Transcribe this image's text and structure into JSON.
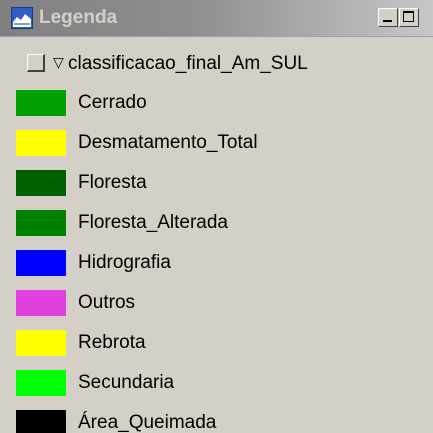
{
  "window": {
    "title": "Legenda"
  },
  "layer": {
    "name": "classificacao_final_Am_SUL",
    "checked": false,
    "expanded": true
  },
  "legend": {
    "items": [
      {
        "label": "Cerrado",
        "color": "#00a000"
      },
      {
        "label": "Desmatamento_Total",
        "color": "#ffff00"
      },
      {
        "label": "Floresta",
        "color": "#006000"
      },
      {
        "label": "Floresta_Alterada",
        "color": "#008000"
      },
      {
        "label": "Hidrografia",
        "color": "#0000ff"
      },
      {
        "label": "Outros",
        "color": "#e040e0"
      },
      {
        "label": "Rebrota",
        "color": "#ffff00"
      },
      {
        "label": "Secundaria",
        "color": "#00ff00"
      },
      {
        "label": "Área_Queimada",
        "color": "#000000"
      }
    ]
  }
}
